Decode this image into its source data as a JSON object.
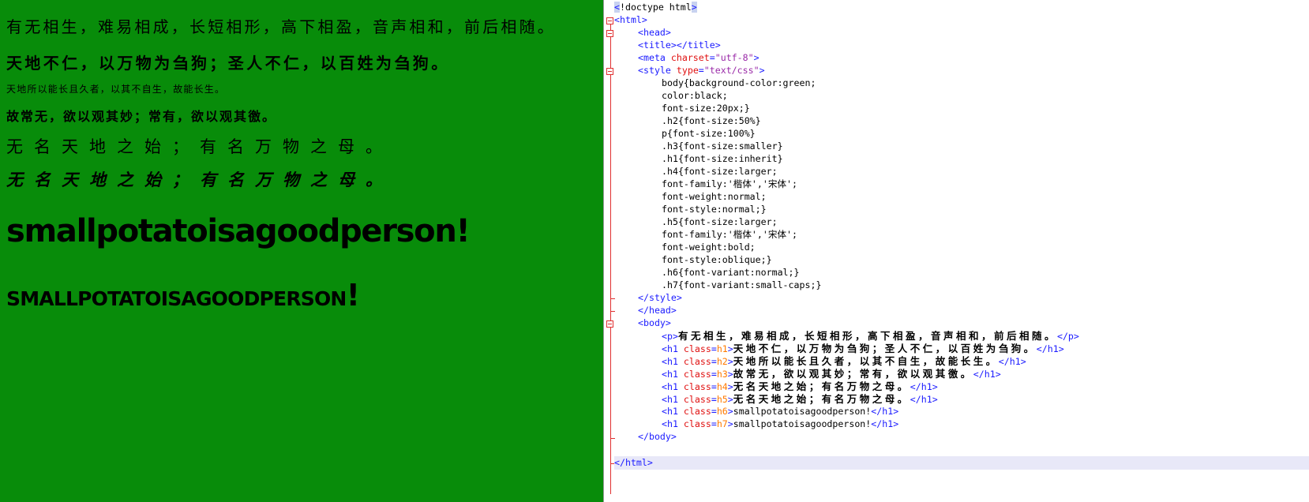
{
  "preview": {
    "line1": "有无相生，难易相成，长短相形，高下相盈，音声相和，前后相随。",
    "line2": "天地不仁，以万物为刍狗；圣人不仁，以百姓为刍狗。",
    "line3": "天地所以能长且久者，以其不自生，故能长生。",
    "line4": "故常无，欲以观其妙；常有，欲以观其徼。",
    "line5": "无名天地之始；有名万物之母。",
    "line6": "无名天地之始；有名万物之母。",
    "line7": "smallpotatoisagoodperson!",
    "line8_text": "SMALLPOTATOISAGOODPERSON",
    "line8_mark": "!"
  },
  "colors": {
    "preview_bg": "#088c0a",
    "tag": "#1a1aff",
    "attr": "#e01010",
    "attr_value": "#9a2aa8",
    "class_value": "#ff7a00"
  },
  "code": {
    "doctype_lt": "<",
    "doctype_rest": "!doctype html",
    "doctype_gt": ">",
    "html_open": "<html>",
    "head_open": "<head>",
    "title": "<title></title>",
    "meta_open": "<meta ",
    "meta_attr": "charset",
    "meta_eq": "=",
    "meta_val": "\"utf-8\"",
    "meta_close": ">",
    "style_open": "<style ",
    "style_attr": "type",
    "style_eq": "=",
    "style_val": "\"text/css\"",
    "style_close": ">",
    "css": [
      "body{background-color:green;",
      "color:black;",
      "font-size:20px;}",
      ".h2{font-size:50%}",
      "p{font-size:100%}",
      ".h3{font-size:smaller}",
      ".h1{font-size:inherit}",
      ".h4{font-size:larger;",
      "font-family:'楷体','宋体';",
      "font-weight:normal;",
      "font-style:normal;}",
      ".h5{font-size:larger;",
      "font-family:'楷体','宋体';",
      "font-weight:bold;",
      "font-style:oblique;}",
      ".h6{font-variant:normal;}",
      ".h7{font-variant:small-caps;}"
    ],
    "style_end": "</style>",
    "head_end": "</head>",
    "body_open": "<body>",
    "p_open": "<p>",
    "p_text": "有无相生，难易相成，长短相形，高下相盈，音声相和，前后相随。",
    "p_close": "</p>",
    "h1_open": "<h1 ",
    "class_attr": "class",
    "eq": "=",
    "gt": ">",
    "h1_close": "</h1>",
    "h_lines": [
      {
        "cls": "h1",
        "text": "天地不仁，以万物为刍狗；圣人不仁，以百姓为刍狗。"
      },
      {
        "cls": "h2",
        "text": "天地所以能长且久者，以其不自生，故能长生。"
      },
      {
        "cls": "h3",
        "text": "故常无，欲以观其妙；常有，欲以观其徼。"
      },
      {
        "cls": "h4",
        "text": "无名天地之始；有名万物之母。"
      },
      {
        "cls": "h5",
        "text": "无名天地之始；有名万物之母。"
      },
      {
        "cls": "h6",
        "text": "smallpotatoisagoodperson!"
      },
      {
        "cls": "h7",
        "text": "smallpotatoisagoodperson!"
      }
    ],
    "body_end": "</body>",
    "html_end": "</html>"
  }
}
